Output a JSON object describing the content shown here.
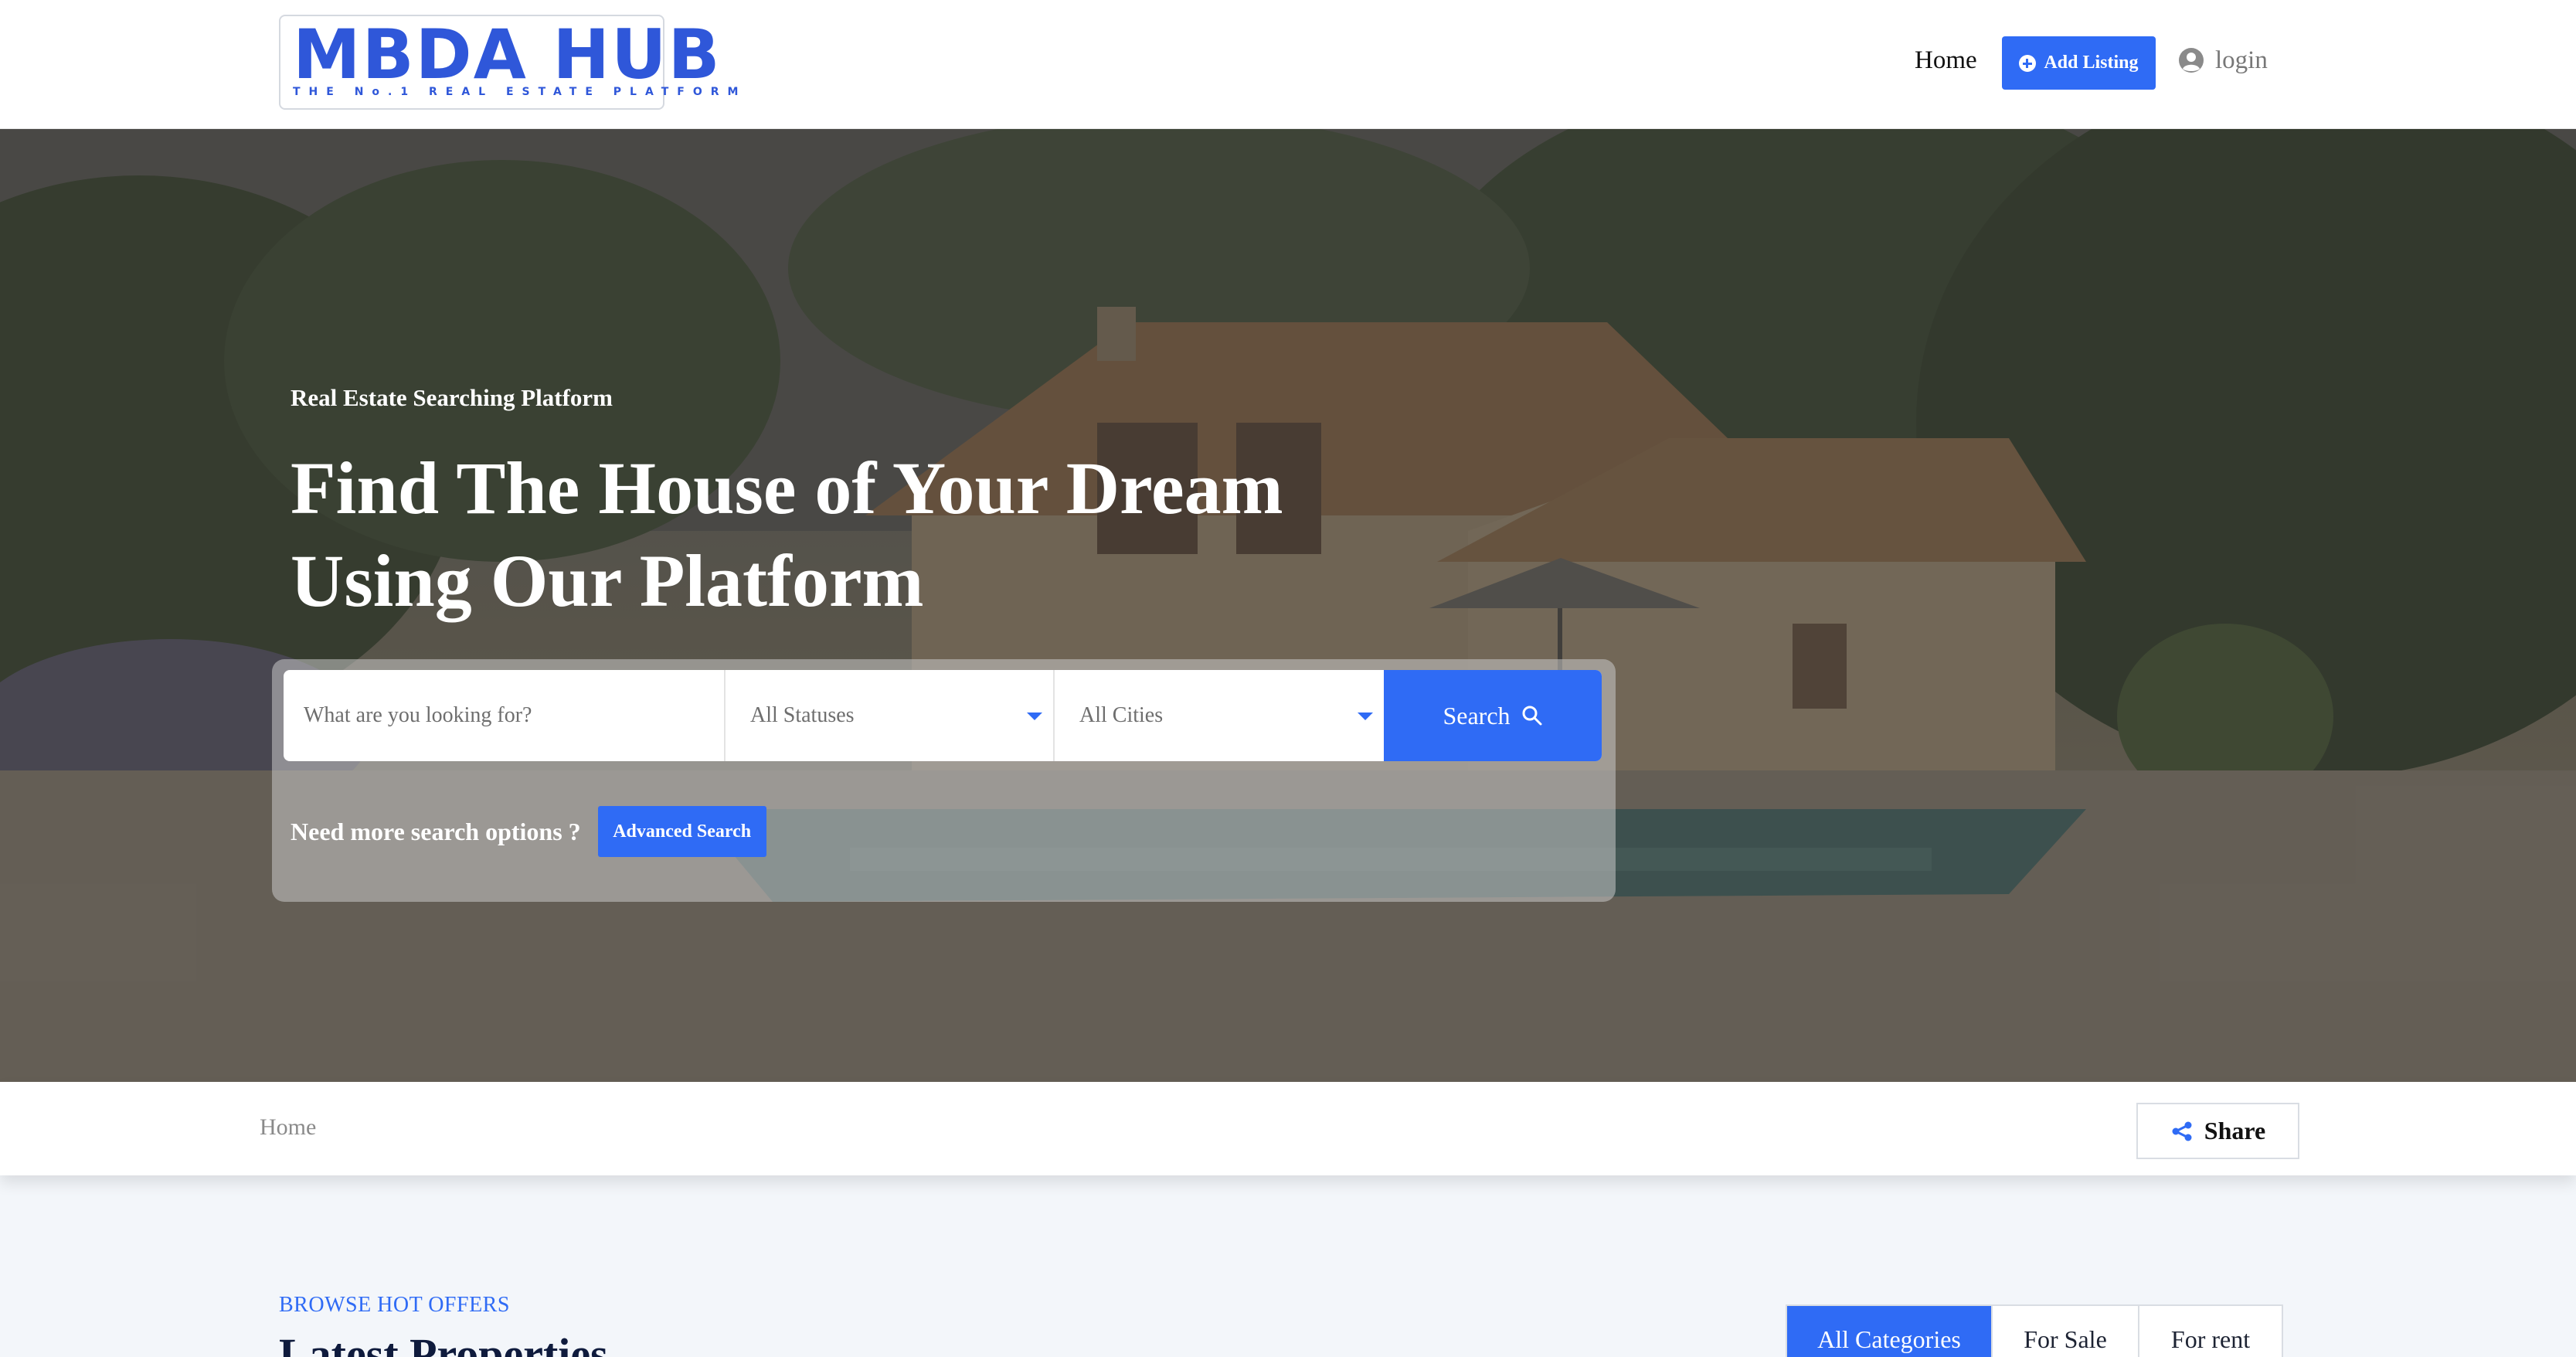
{
  "header": {
    "logo_text": "MBDA HUB",
    "logo_tagline": "THE No.1 REAL ESTATE PLATFORM",
    "nav_home": "Home",
    "add_listing_label": "Add Listing",
    "login_label": "login"
  },
  "hero": {
    "kicker": "Real Estate Searching Platform",
    "title_line1": "Find The House of Your Dream",
    "title_line2": "Using Our Platform",
    "search": {
      "keyword_placeholder": "What are you looking for?",
      "status_value": "All Statuses",
      "city_value": "All Cities",
      "search_label": "Search"
    },
    "advanced_question": "Need more search options ?",
    "advanced_label": "Advanced Search"
  },
  "breadcrumb": {
    "current": "Home",
    "share_label": "Share"
  },
  "listings": {
    "eyebrow": "BROWSE HOT OFFERS",
    "title": "Latest Properties",
    "tabs": [
      "All Categories",
      "For Sale",
      "For rent"
    ]
  },
  "colors": {
    "accent": "#2f6bf5",
    "logo": "#2f57d9",
    "section_bg": "#f3f6fa",
    "heading": "#0f1b3d"
  },
  "icons": {
    "add": "plus-circle-icon",
    "user": "user-circle-icon",
    "search": "search-icon",
    "share": "share-icon",
    "dropdown": "caret-down-icon"
  }
}
